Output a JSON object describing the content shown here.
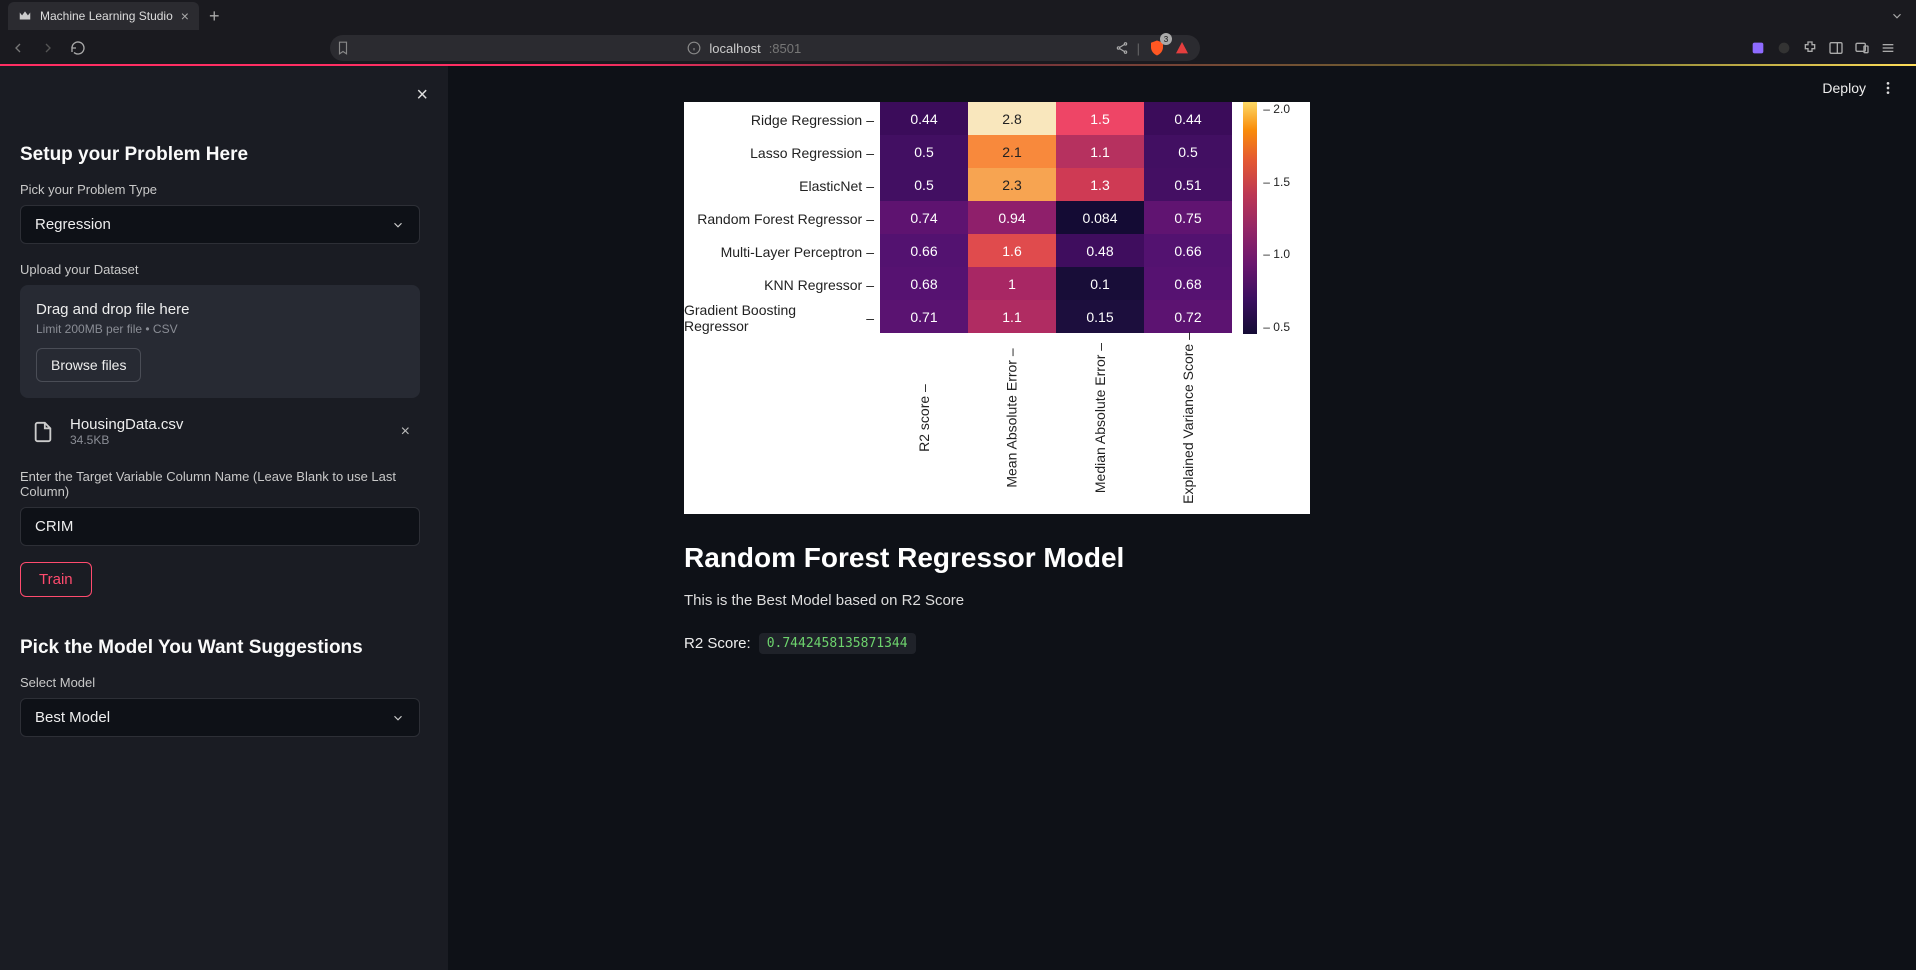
{
  "browser": {
    "tab_title": "Machine Learning Studio",
    "url_host": "localhost",
    "url_port": ":8501",
    "brave_count": "3"
  },
  "header": {
    "deploy": "Deploy"
  },
  "sidebar": {
    "title": "Setup your Problem Here",
    "problem_type_label": "Pick your Problem Type",
    "problem_type_value": "Regression",
    "upload_label": "Upload your Dataset",
    "dropzone_title": "Drag and drop file here",
    "dropzone_sub": "Limit 200MB per file • CSV",
    "browse_label": "Browse files",
    "file_name": "HousingData.csv",
    "file_size": "34.5KB",
    "target_label": "Enter the Target Variable Column Name (Leave Blank to use Last Column)",
    "target_value": "CRIM",
    "train_label": "Train",
    "suggestions_title": "Pick the Model You Want Suggestions",
    "select_model_label": "Select Model",
    "select_model_value": "Best Model"
  },
  "main": {
    "best_model_heading": "Random Forest Regressor Model",
    "best_model_sub": "This is the Best Model based on R2 Score",
    "r2_label": "R2 Score:",
    "r2_value": "0.7442458135871344"
  },
  "chart_data": {
    "type": "heatmap",
    "row_labels": [
      "Ridge Regression",
      "Lasso Regression",
      "ElasticNet",
      "Random Forest Regressor",
      "Multi-Layer Perceptron",
      "KNN Regressor",
      "Gradient Boosting Regressor"
    ],
    "col_labels": [
      "R2 score",
      "Mean Absolute Error",
      "Median Absolute Error",
      "Explained Variance Score"
    ],
    "values": [
      [
        0.44,
        2.8,
        1.5,
        0.44
      ],
      [
        0.5,
        2.1,
        1.1,
        0.5
      ],
      [
        0.5,
        2.3,
        1.3,
        0.51
      ],
      [
        0.74,
        0.94,
        0.084,
        0.75
      ],
      [
        0.66,
        1.6,
        0.48,
        0.66
      ],
      [
        0.68,
        1,
        0.1,
        0.68
      ],
      [
        0.71,
        1.1,
        0.15,
        0.72
      ]
    ],
    "display_values": [
      [
        "0.44",
        "2.8",
        "1.5",
        "0.44"
      ],
      [
        "0.5",
        "2.1",
        "1.1",
        "0.5"
      ],
      [
        "0.5",
        "2.3",
        "1.3",
        "0.51"
      ],
      [
        "0.74",
        "0.94",
        "0.084",
        "0.75"
      ],
      [
        "0.66",
        "1.6",
        "0.48",
        "0.66"
      ],
      [
        "0.68",
        "1",
        "0.1",
        "0.68"
      ],
      [
        "0.71",
        "1.1",
        "0.15",
        "0.72"
      ]
    ],
    "cell_colors": [
      [
        "#3b0c5a",
        "#f9e7bd",
        "#ee4566",
        "#3b0c5a"
      ],
      [
        "#420f62",
        "#f8893c",
        "#b6315f",
        "#420f62"
      ],
      [
        "#420f62",
        "#f7a451",
        "#cf3a54",
        "#440f63"
      ],
      [
        "#5e1370",
        "#8f1f6b",
        "#140b34",
        "#601471"
      ],
      [
        "#531270",
        "#e04b4d",
        "#3f0d5e",
        "#531270"
      ],
      [
        "#561271",
        "#a82764",
        "#180d38",
        "#561271"
      ],
      [
        "#5a1371",
        "#b02c62",
        "#1c0e3d",
        "#5c1371"
      ]
    ],
    "text_colors": [
      [
        "#fff",
        "#222",
        "#fff",
        "#fff"
      ],
      [
        "#fff",
        "#222",
        "#fff",
        "#fff"
      ],
      [
        "#fff",
        "#222",
        "#fff",
        "#fff"
      ],
      [
        "#fff",
        "#fff",
        "#fff",
        "#fff"
      ],
      [
        "#fff",
        "#fff",
        "#fff",
        "#fff"
      ],
      [
        "#fff",
        "#fff",
        "#fff",
        "#fff"
      ],
      [
        "#fff",
        "#fff",
        "#fff",
        "#fff"
      ]
    ],
    "colorbar_ticks": [
      "2.0",
      "1.5",
      "1.0",
      "0.5"
    ],
    "title": "",
    "xlabel": "",
    "ylabel": ""
  }
}
